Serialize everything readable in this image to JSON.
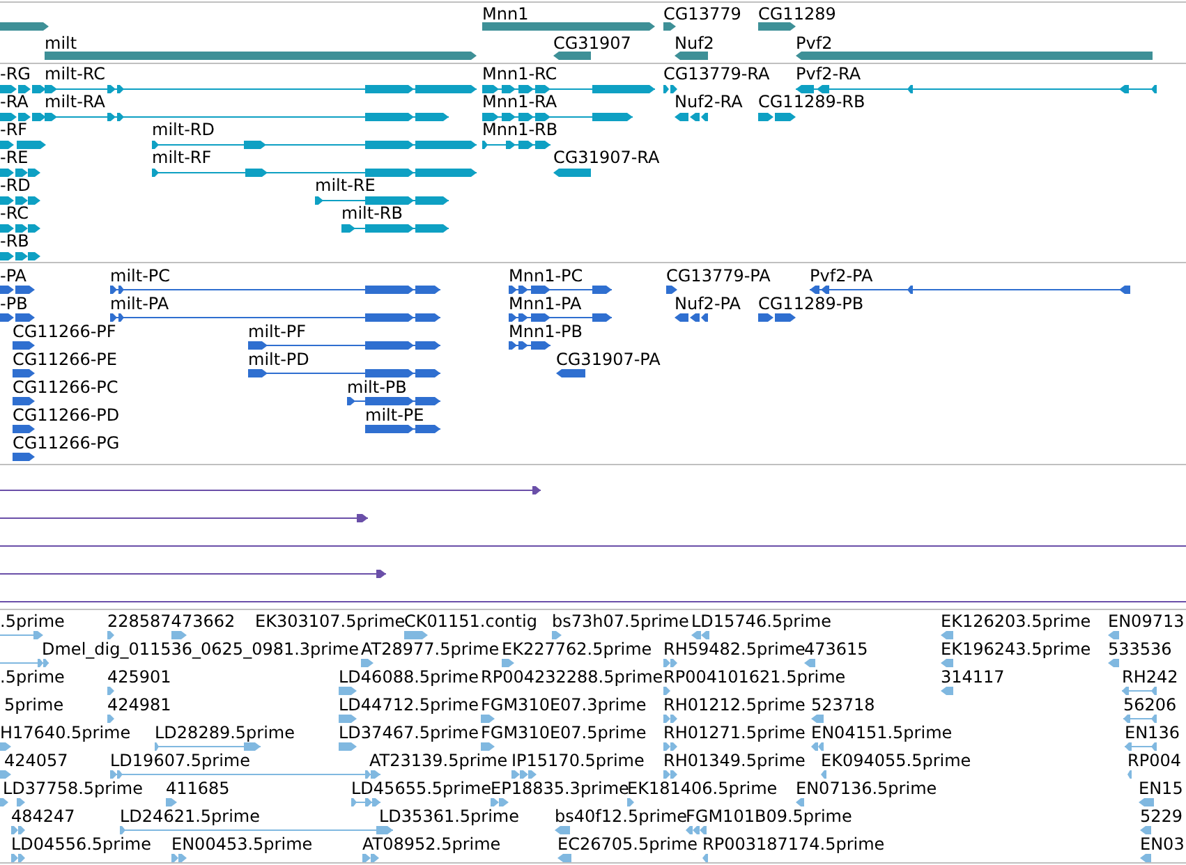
{
  "tracks": [
    {
      "kind": "gene",
      "features": [
        {
          "kind": "glyph"
        },
        {
          "kind": "labeled",
          "label": "Mnn1"
        },
        {
          "kind": "labeled",
          "label": "CG13779"
        },
        {
          "kind": "labeled",
          "label": "CG11289"
        },
        {
          "kind": "labeled",
          "label": "milt"
        },
        {
          "kind": "labeled",
          "label": "CG31907"
        },
        {
          "kind": "labeled",
          "label": "Nuf2"
        },
        {
          "kind": "labeled",
          "label": "Pvf2"
        }
      ]
    },
    {
      "kind": "transcript",
      "features": [
        {
          "kind": "labeled",
          "label": "-RG"
        },
        {
          "kind": "labeled",
          "label": "-RA"
        },
        {
          "kind": "labeled",
          "label": "-RF"
        },
        {
          "kind": "labeled",
          "label": "-RE"
        },
        {
          "kind": "labeled",
          "label": "-RD"
        },
        {
          "kind": "labeled",
          "label": "-RC"
        },
        {
          "kind": "labeled",
          "label": "-RB"
        },
        {
          "kind": "labeled",
          "label": "milt-RC"
        },
        {
          "kind": "labeled",
          "label": "milt-RA"
        },
        {
          "kind": "labeled",
          "label": "milt-RD"
        },
        {
          "kind": "labeled",
          "label": "milt-RF"
        },
        {
          "kind": "labeled",
          "label": "milt-RE"
        },
        {
          "kind": "labeled",
          "label": "milt-RB"
        },
        {
          "kind": "labeled",
          "label": "Mnn1-RC"
        },
        {
          "kind": "labeled",
          "label": "Mnn1-RA"
        },
        {
          "kind": "labeled",
          "label": "Mnn1-RB"
        },
        {
          "kind": "labeled",
          "label": "CG31907-RA"
        },
        {
          "kind": "labeled",
          "label": "CG13779-RA"
        },
        {
          "kind": "labeled",
          "label": "Nuf2-RA"
        },
        {
          "kind": "labeled",
          "label": "CG11289-RB"
        },
        {
          "kind": "labeled",
          "label": "Pvf2-RA"
        }
      ]
    },
    {
      "kind": "protein",
      "features": [
        {
          "kind": "labeled",
          "label": "-PA"
        },
        {
          "kind": "labeled",
          "label": "-PB"
        },
        {
          "kind": "labeled",
          "label": "CG11266-PF"
        },
        {
          "kind": "labeled",
          "label": "CG11266-PE"
        },
        {
          "kind": "labeled",
          "label": "CG11266-PC"
        },
        {
          "kind": "labeled",
          "label": "CG11266-PD"
        },
        {
          "kind": "labeled",
          "label": "CG11266-PG"
        },
        {
          "kind": "labeled",
          "label": "milt-PC"
        },
        {
          "kind": "labeled",
          "label": "milt-PA"
        },
        {
          "kind": "labeled",
          "label": "milt-PF"
        },
        {
          "kind": "labeled",
          "label": "milt-PD"
        },
        {
          "kind": "labeled",
          "label": "milt-PB"
        },
        {
          "kind": "labeled",
          "label": "milt-PE"
        },
        {
          "kind": "labeled",
          "label": "Mnn1-PC"
        },
        {
          "kind": "labeled",
          "label": "Mnn1-PA"
        },
        {
          "kind": "labeled",
          "label": "Mnn1-PB"
        },
        {
          "kind": "labeled",
          "label": "CG31907-PA"
        },
        {
          "kind": "labeled",
          "label": "CG13779-PA"
        },
        {
          "kind": "labeled",
          "label": "Nuf2-PA"
        },
        {
          "kind": "labeled",
          "label": "CG11289-PB"
        },
        {
          "kind": "labeled",
          "label": "Pvf2-PA"
        }
      ]
    },
    {
      "kind": "alignment",
      "features": [
        {
          "kind": "glyph"
        },
        {
          "kind": "glyph"
        },
        {
          "kind": "glyph"
        },
        {
          "kind": "glyph"
        },
        {
          "kind": "glyph"
        }
      ]
    },
    {
      "kind": "est",
      "features": [
        {
          "kind": "labeled",
          "label": ".5prime"
        },
        {
          "kind": "labeled",
          "label": "228587473662"
        },
        {
          "kind": "labeled",
          "label": "EK303107.5prime"
        },
        {
          "kind": "labeled",
          "label": "CK01151.contig"
        },
        {
          "kind": "labeled",
          "label": "bs73h07.5prime"
        },
        {
          "kind": "labeled",
          "label": "LD15746.5prime"
        },
        {
          "kind": "labeled",
          "label": "EK126203.5prime"
        },
        {
          "kind": "labeled",
          "label": "EN09713"
        },
        {
          "kind": "glyph"
        },
        {
          "kind": "labeled",
          "label": "Dmel_dig_011536_0625_0981.3prime"
        },
        {
          "kind": "labeled",
          "label": "AT28977.5prime"
        },
        {
          "kind": "labeled",
          "label": "EK227762.5prime"
        },
        {
          "kind": "labeled",
          "label": "RH59482.5prime"
        },
        {
          "kind": "labeled",
          "label": "473615"
        },
        {
          "kind": "labeled",
          "label": "EK196243.5prime"
        },
        {
          "kind": "labeled",
          "label": "533536"
        },
        {
          "kind": "labeled",
          "label": ".5prime"
        },
        {
          "kind": "labeled",
          "label": "425901"
        },
        {
          "kind": "labeled",
          "label": "LD46088.5prime"
        },
        {
          "kind": "labeled",
          "label": "RP004232288.5prime"
        },
        {
          "kind": "labeled",
          "label": "RP004101621.5prime"
        },
        {
          "kind": "labeled",
          "label": "314117"
        },
        {
          "kind": "labeled",
          "label": "RH242"
        },
        {
          "kind": "labeled",
          "label": "5prime"
        },
        {
          "kind": "labeled",
          "label": "424981"
        },
        {
          "kind": "labeled",
          "label": "LD44712.5prime"
        },
        {
          "kind": "labeled",
          "label": "FGM310E07.3prime"
        },
        {
          "kind": "labeled",
          "label": "RH01212.5prime"
        },
        {
          "kind": "labeled",
          "label": "523718"
        },
        {
          "kind": "labeled",
          "label": "56206"
        },
        {
          "kind": "labeled",
          "label": "H17640.5prime"
        },
        {
          "kind": "labeled",
          "label": "LD28289.5prime"
        },
        {
          "kind": "labeled",
          "label": "LD37467.5prime"
        },
        {
          "kind": "labeled",
          "label": "FGM310E07.5prime"
        },
        {
          "kind": "labeled",
          "label": "RH01271.5prime"
        },
        {
          "kind": "labeled",
          "label": "EN04151.5prime"
        },
        {
          "kind": "labeled",
          "label": "EN136"
        },
        {
          "kind": "labeled",
          "label": "424057"
        },
        {
          "kind": "labeled",
          "label": "LD19607.5prime"
        },
        {
          "kind": "labeled",
          "label": "AT23139.5prime"
        },
        {
          "kind": "labeled",
          "label": "IP15170.5prime"
        },
        {
          "kind": "labeled",
          "label": "RH01349.5prime"
        },
        {
          "kind": "labeled",
          "label": "EK094055.5prime"
        },
        {
          "kind": "labeled",
          "label": "RP004"
        },
        {
          "kind": "labeled",
          "label": "LD37758.5prime"
        },
        {
          "kind": "labeled",
          "label": "411685"
        },
        {
          "kind": "labeled",
          "label": "LD45655.5prime"
        },
        {
          "kind": "labeled",
          "label": "EP18835.3prime"
        },
        {
          "kind": "labeled",
          "label": "EK181406.5prime"
        },
        {
          "kind": "labeled",
          "label": "EN07136.5prime"
        },
        {
          "kind": "labeled",
          "label": "EN15"
        },
        {
          "kind": "labeled",
          "label": "484247"
        },
        {
          "kind": "labeled",
          "label": "LD24621.5prime"
        },
        {
          "kind": "labeled",
          "label": "LD35361.5prime"
        },
        {
          "kind": "labeled",
          "label": "bs40f12.5prime"
        },
        {
          "kind": "labeled",
          "label": "FGM101B09.5prime"
        },
        {
          "kind": "labeled",
          "label": "5229"
        },
        {
          "kind": "labeled",
          "label": "LD04556.5prime"
        },
        {
          "kind": "labeled",
          "label": "EN00453.5prime"
        },
        {
          "kind": "labeled",
          "label": "AT08952.5prime"
        },
        {
          "kind": "labeled",
          "label": "EC26705.5prime"
        },
        {
          "kind": "labeled",
          "label": "RP003187174.5prime"
        },
        {
          "kind": "labeled",
          "label": "EN03"
        }
      ]
    }
  ]
}
